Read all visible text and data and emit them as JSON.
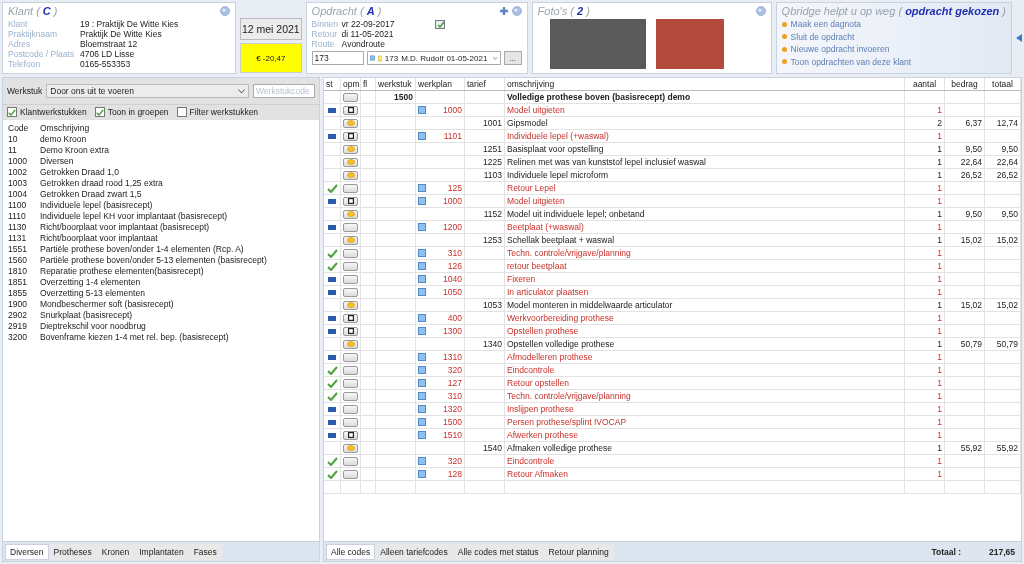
{
  "klant": {
    "title": "Klant ( **C** )",
    "fields": [
      {
        "label": "Klant",
        "value": "19 : Praktijk De Witte Kies"
      },
      {
        "label": "Praktijknaam",
        "value": "Praktijk De Witte Kies"
      },
      {
        "label": "Adres",
        "value": "Bloemstraat 12"
      },
      {
        "label": "Postcode / Plaats",
        "value": "4706 LD  Lisse"
      },
      {
        "label": "Telefoon",
        "value": "0165-553353"
      }
    ]
  },
  "date": "12 mei 2021",
  "balance": "€ -20,47",
  "opdracht": {
    "title": "Opdracht ( **A** )",
    "fields": [
      {
        "label": "Binnen",
        "value": "vr 22-09-2017"
      },
      {
        "label": "Retour",
        "value": "di 11-05-2021"
      },
      {
        "label": "Route",
        "value": "Avondroute"
      }
    ],
    "number": "173",
    "dentist": {
      "code": "173",
      "name": "M.D. Rudolf",
      "date": "01-05-2021"
    },
    "more_button": "..."
  },
  "fotos": {
    "title": "Foto's ( **2** )",
    "photos": [
      {
        "kind": "xray"
      },
      {
        "kind": "smile"
      }
    ]
  },
  "qbridge": {
    "title": "Qbridge helpt u op weg ( **opdracht gekozen** )",
    "links": [
      "Maak een dagnota",
      "Sluit de opdracht",
      "Nieuwe opdracht invoeren",
      "Toon opdrachten van deze klant"
    ]
  },
  "werkstuk": {
    "label": "Werkstuk",
    "value": "Door ons uit te voeren",
    "code_placeholder": "Werkstukcode",
    "filters": [
      {
        "label": "Klantwerkstukken",
        "checked": true
      },
      {
        "label": "Toon in groepen",
        "checked": true
      },
      {
        "label": "Filter werkstukken",
        "checked": false
      }
    ],
    "columns": [
      "Code",
      "Omschrijving"
    ],
    "items": [
      {
        "code": "10",
        "description": "demo Kroon"
      },
      {
        "code": "11",
        "description": "Demo Kroon extra"
      },
      {
        "code": "1000",
        "description": "Diversen"
      },
      {
        "code": "1002",
        "description": "Getrokken Draad 1,0"
      },
      {
        "code": "1003",
        "description": "Getrokken draad rood 1,25 extra"
      },
      {
        "code": "1004",
        "description": "Getrokken Draad zwart 1,5"
      },
      {
        "code": "1100",
        "description": "Individuele lepel (basisrecept)"
      },
      {
        "code": "1110",
        "description": "Individuele lepel KH voor implantaat (basisrecept)"
      },
      {
        "code": "1130",
        "description": "Richt/boorplaat voor implantaat (basisrecept)"
      },
      {
        "code": "1131",
        "description": "Richt/boorplaat voor implantaat"
      },
      {
        "code": "1551",
        "description": "Partiële prothese boven/onder 1-4 elementen (Rcp. A)"
      },
      {
        "code": "1560",
        "description": "Partiële prothese boven/onder 5-13 elementen (basisrecept)"
      },
      {
        "code": "1810",
        "description": "Reparatie prothese elementen(basisrecept)"
      },
      {
        "code": "1851",
        "description": "Overzetting 1-4 elementen"
      },
      {
        "code": "1855",
        "description": "Overzetting 5-13 elementen"
      },
      {
        "code": "1900",
        "description": "Mondbeschermer soft (basisrecept)"
      },
      {
        "code": "2902",
        "description": "Snurkplaat (basisrecept)"
      },
      {
        "code": "2919",
        "description": "Dieptrekschil voor noodbrug"
      },
      {
        "code": "3200",
        "description": "Bovenframe kiezen 1-4 met rel. bep. (basisrecept)"
      }
    ],
    "tabs": [
      {
        "label": "Diversen",
        "selected": true
      },
      {
        "label": "Protheses",
        "selected": false
      },
      {
        "label": "Kronen",
        "selected": false
      },
      {
        "label": "Implantaten",
        "selected": false
      },
      {
        "label": "Fases",
        "selected": false
      }
    ]
  },
  "table": {
    "columns": [
      "st",
      "opm",
      "fl",
      "werkstuk",
      "werkplan",
      "tarief",
      "omschrijving",
      "aantal",
      "bedrag",
      "totaal"
    ],
    "rows": [
      {
        "kind": "group",
        "noted": false,
        "code": "1500",
        "description": "Volledige prothese boven (basisrecept) demo"
      },
      {
        "kind": "plan",
        "done": false,
        "noted": true,
        "code": "1000",
        "description": "Model uitgieten",
        "aantal": "1"
      },
      {
        "kind": "tariff",
        "code": "1001",
        "description": "Gipsmodel",
        "aantal": "2",
        "bedrag": "6,37",
        "totaal": "12,74"
      },
      {
        "kind": "plan",
        "done": false,
        "noted": true,
        "code": "1101",
        "description": "Individuele lepel (+waswal)",
        "aantal": "1"
      },
      {
        "kind": "tariff",
        "code": "1251",
        "description": "Basisplaat voor opstelling",
        "aantal": "1",
        "bedrag": "9,50",
        "totaal": "9,50"
      },
      {
        "kind": "tariff",
        "code": "1225",
        "description": "Relinen met was van kunststof lepel inclusief waswal",
        "aantal": "1",
        "bedrag": "22,64",
        "totaal": "22,64"
      },
      {
        "kind": "tariff",
        "code": "1103",
        "description": "Individuele lepel microform",
        "aantal": "1",
        "bedrag": "26,52",
        "totaal": "26,52"
      },
      {
        "kind": "plan",
        "done": true,
        "noted": false,
        "code": "125",
        "description": "Retour Lepel",
        "aantal": "1"
      },
      {
        "kind": "plan",
        "done": false,
        "noted": true,
        "code": "1000",
        "description": "Model uitgieten",
        "aantal": "1"
      },
      {
        "kind": "tariff",
        "code": "1152",
        "description": "Model uit individuele lepel; onbetand",
        "aantal": "1",
        "bedrag": "9,50",
        "totaal": "9,50"
      },
      {
        "kind": "plan",
        "done": false,
        "noted": false,
        "code": "1200",
        "description": "Beetplaat (+waswal)",
        "aantal": "1"
      },
      {
        "kind": "tariff",
        "code": "1253",
        "description": "Schellak beetplaat + waswal",
        "aantal": "1",
        "bedrag": "15,02",
        "totaal": "15,02"
      },
      {
        "kind": "plan",
        "done": true,
        "noted": false,
        "code": "310",
        "description": "Techn. controle/vrijgave/planning",
        "aantal": "1"
      },
      {
        "kind": "plan",
        "done": true,
        "noted": false,
        "code": "126",
        "description": "retour beetplaat",
        "aantal": "1"
      },
      {
        "kind": "plan",
        "done": false,
        "noted": false,
        "code": "1040",
        "description": "Fixeren",
        "aantal": "1"
      },
      {
        "kind": "plan",
        "done": false,
        "noted": false,
        "code": "1050",
        "description": "In articulator plaatsen",
        "aantal": "1"
      },
      {
        "kind": "tariff",
        "code": "1053",
        "description": "Model monteren in middelwaarde articulator",
        "aantal": "1",
        "bedrag": "15,02",
        "totaal": "15,02"
      },
      {
        "kind": "plan",
        "done": false,
        "noted": true,
        "code": "400",
        "description": "Werkvoorbereiding prothese",
        "aantal": "1"
      },
      {
        "kind": "plan",
        "done": false,
        "noted": true,
        "code": "1300",
        "description": "Opstellen prothese",
        "aantal": "1"
      },
      {
        "kind": "tariff",
        "code": "1340",
        "description": "Opstellen volledige prothese",
        "aantal": "1",
        "bedrag": "50,79",
        "totaal": "50,79"
      },
      {
        "kind": "plan",
        "done": false,
        "noted": false,
        "code": "1310",
        "description": "Afmodelleren prothese",
        "aantal": "1"
      },
      {
        "kind": "plan",
        "done": true,
        "noted": false,
        "code": "320",
        "description": "Eindcontrole",
        "aantal": "1"
      },
      {
        "kind": "plan",
        "done": true,
        "noted": false,
        "code": "127",
        "description": "Retour opstellen",
        "aantal": "1"
      },
      {
        "kind": "plan",
        "done": true,
        "noted": false,
        "code": "310",
        "description": "Techn. controle/vrijgave/planning",
        "aantal": "1"
      },
      {
        "kind": "plan",
        "done": false,
        "noted": false,
        "code": "1320",
        "description": "Inslijpen prothese",
        "aantal": "1"
      },
      {
        "kind": "plan",
        "done": false,
        "noted": false,
        "code": "1500",
        "description": "Persen prothese/splint IVOCAP",
        "aantal": "1"
      },
      {
        "kind": "plan",
        "done": false,
        "noted": true,
        "code": "1510",
        "description": "Afwerken prothese",
        "aantal": "1"
      },
      {
        "kind": "tariff",
        "code": "1540",
        "description": "Afmaken volledige prothese",
        "aantal": "1",
        "bedrag": "55,92",
        "totaal": "55,92"
      },
      {
        "kind": "plan",
        "done": true,
        "noted": false,
        "code": "320",
        "description": "Eindcontrole",
        "aantal": "1"
      },
      {
        "kind": "plan",
        "done": true,
        "noted": false,
        "code": "128",
        "description": "Retour Afmaken",
        "aantal": "1"
      }
    ],
    "tabs": [
      {
        "label": "Alle codes",
        "selected": true
      },
      {
        "label": "Alleen tariefcodes",
        "selected": false
      },
      {
        "label": "Alle codes met status",
        "selected": false
      },
      {
        "label": "Retour planning",
        "selected": false
      }
    ],
    "total_label": "Totaal :",
    "total": "217,65"
  }
}
